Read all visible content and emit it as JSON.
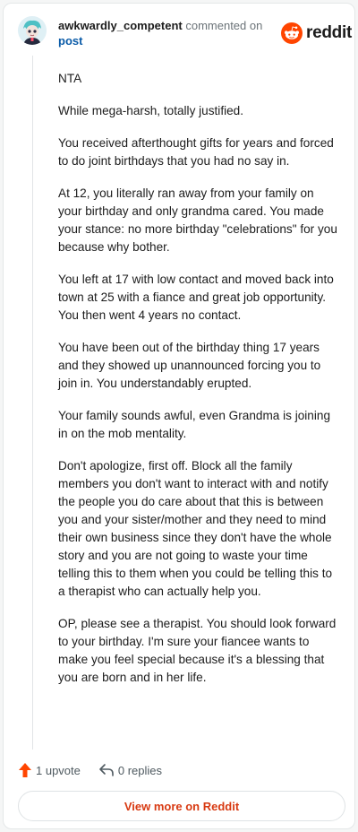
{
  "comment": {
    "username": "awkwardly_competent",
    "action": "commented on",
    "post_link": "post",
    "paragraphs": [
      "NTA",
      "While mega-harsh, totally justified.",
      "You received afterthought gifts for years and forced to do joint birthdays that you had no say in.",
      "At 12, you literally ran away from your family on your birthday and only grandma cared. You made your stance: no more birthday \"celebrations\" for you because why bother.",
      "You left at 17 with low contact and moved back into town at 25 with a fiance and great job opportunity. You then went 4 years no contact.",
      "You have been out of the birthday thing 17 years and they showed up unannounced forcing you to join in. You understandably erupted.",
      "Your family sounds awful, even Grandma is joining in on the mob mentality.",
      "Don't apologize, first off. Block all the family members you don't want to interact with and notify the people you do care about that this is between you and your sister/mother and they need to mind their own business since they don't have the whole story and you are not going to waste your time telling this to them when you could be telling this to a therapist who can actually help you.",
      "OP, please see a therapist. You should look forward to your birthday. I'm sure your fiancee wants to make you feel special because it's a blessing that you are born and in her life."
    ]
  },
  "brand": {
    "name": "reddit",
    "color": "#ff4500",
    "icon": "reddit-logo-icon"
  },
  "footer": {
    "upvotes": "1 upvote",
    "replies": "0 replies",
    "upvote_icon": "upvote-arrow-icon",
    "reply_icon": "reply-arrow-icon",
    "upvote_color": "#ff4500"
  },
  "cta": {
    "label": "View more on Reddit",
    "color": "#d83a12"
  }
}
